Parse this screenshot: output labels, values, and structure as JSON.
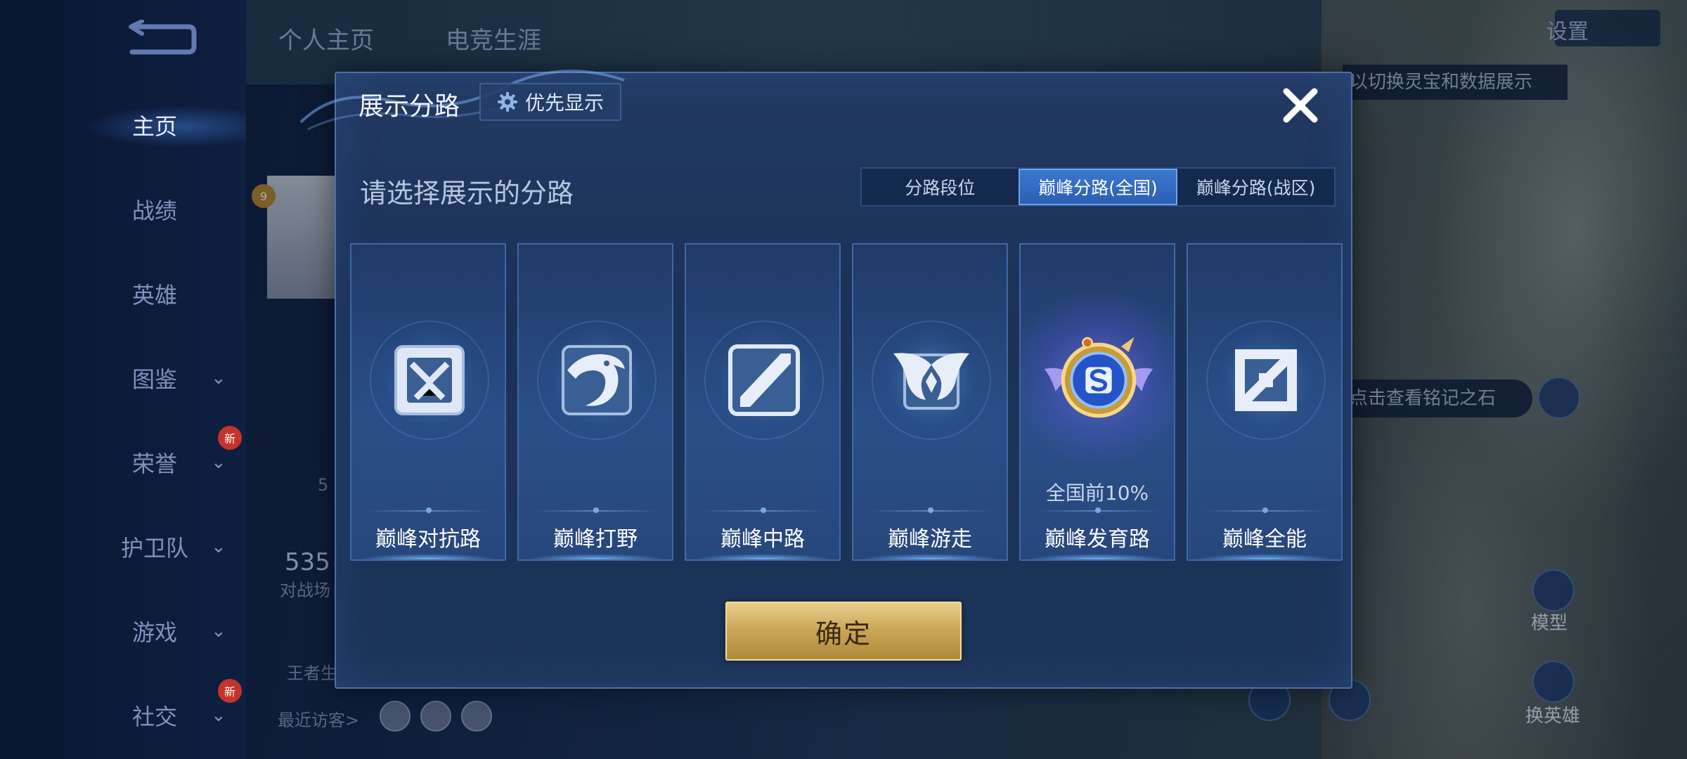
{
  "background": {
    "nav": [
      {
        "label": "主页",
        "active": true,
        "chevron": false,
        "new": false
      },
      {
        "label": "战绩",
        "active": false,
        "chevron": false,
        "new": false
      },
      {
        "label": "英雄",
        "active": false,
        "chevron": false,
        "new": false
      },
      {
        "label": "图鉴",
        "active": false,
        "chevron": true,
        "new": false
      },
      {
        "label": "荣誉",
        "active": false,
        "chevron": true,
        "new": true
      },
      {
        "label": "护卫队",
        "active": false,
        "chevron": true,
        "new": false
      },
      {
        "label": "游戏",
        "active": false,
        "chevron": true,
        "new": false
      },
      {
        "label": "社交",
        "active": false,
        "chevron": true,
        "new": true
      }
    ],
    "new_badge": "新",
    "tabs": [
      "个人主页",
      "电竞生涯"
    ],
    "settings_label": "设置",
    "tip_top": "以切换灵宝和数据展示",
    "tip_mid": "点击查看铭记之石",
    "side_buttons": {
      "model": "模型",
      "switch_hero": "换英雄"
    },
    "level_badge": "9",
    "stat_number": "535",
    "stat_label": "对战场",
    "partial_left_1": "5",
    "partial_left_2": "王者生",
    "recent_visitors": "最近访客>"
  },
  "modal": {
    "title": "展示分路",
    "priority_label": "优先显示",
    "subtitle": "请选择展示的分路",
    "segments": [
      {
        "label": "分路段位",
        "selected": false
      },
      {
        "label": "巅峰分路(全国)",
        "selected": true
      },
      {
        "label": "巅峰分路(战区)",
        "selected": false
      }
    ],
    "cards": [
      {
        "name": "巅峰对抗路",
        "icon": "crossed-swords-icon",
        "rank": "",
        "selected": false
      },
      {
        "name": "巅峰打野",
        "icon": "dragon-icon",
        "rank": "",
        "selected": false
      },
      {
        "name": "巅峰中路",
        "icon": "slash-icon",
        "rank": "",
        "selected": false
      },
      {
        "name": "巅峰游走",
        "icon": "wings-icon",
        "rank": "",
        "selected": false
      },
      {
        "name": "巅峰发育路",
        "icon": "gold-emblem-icon",
        "rank": "全国前10%",
        "selected": true
      },
      {
        "name": "巅峰全能",
        "icon": "all-round-icon",
        "rank": "",
        "selected": false
      }
    ],
    "confirm_label": "确定"
  },
  "colors": {
    "modal_bg": "#1d3459",
    "segment_active": "#3b78cf",
    "confirm_gold": "#c9a554"
  }
}
